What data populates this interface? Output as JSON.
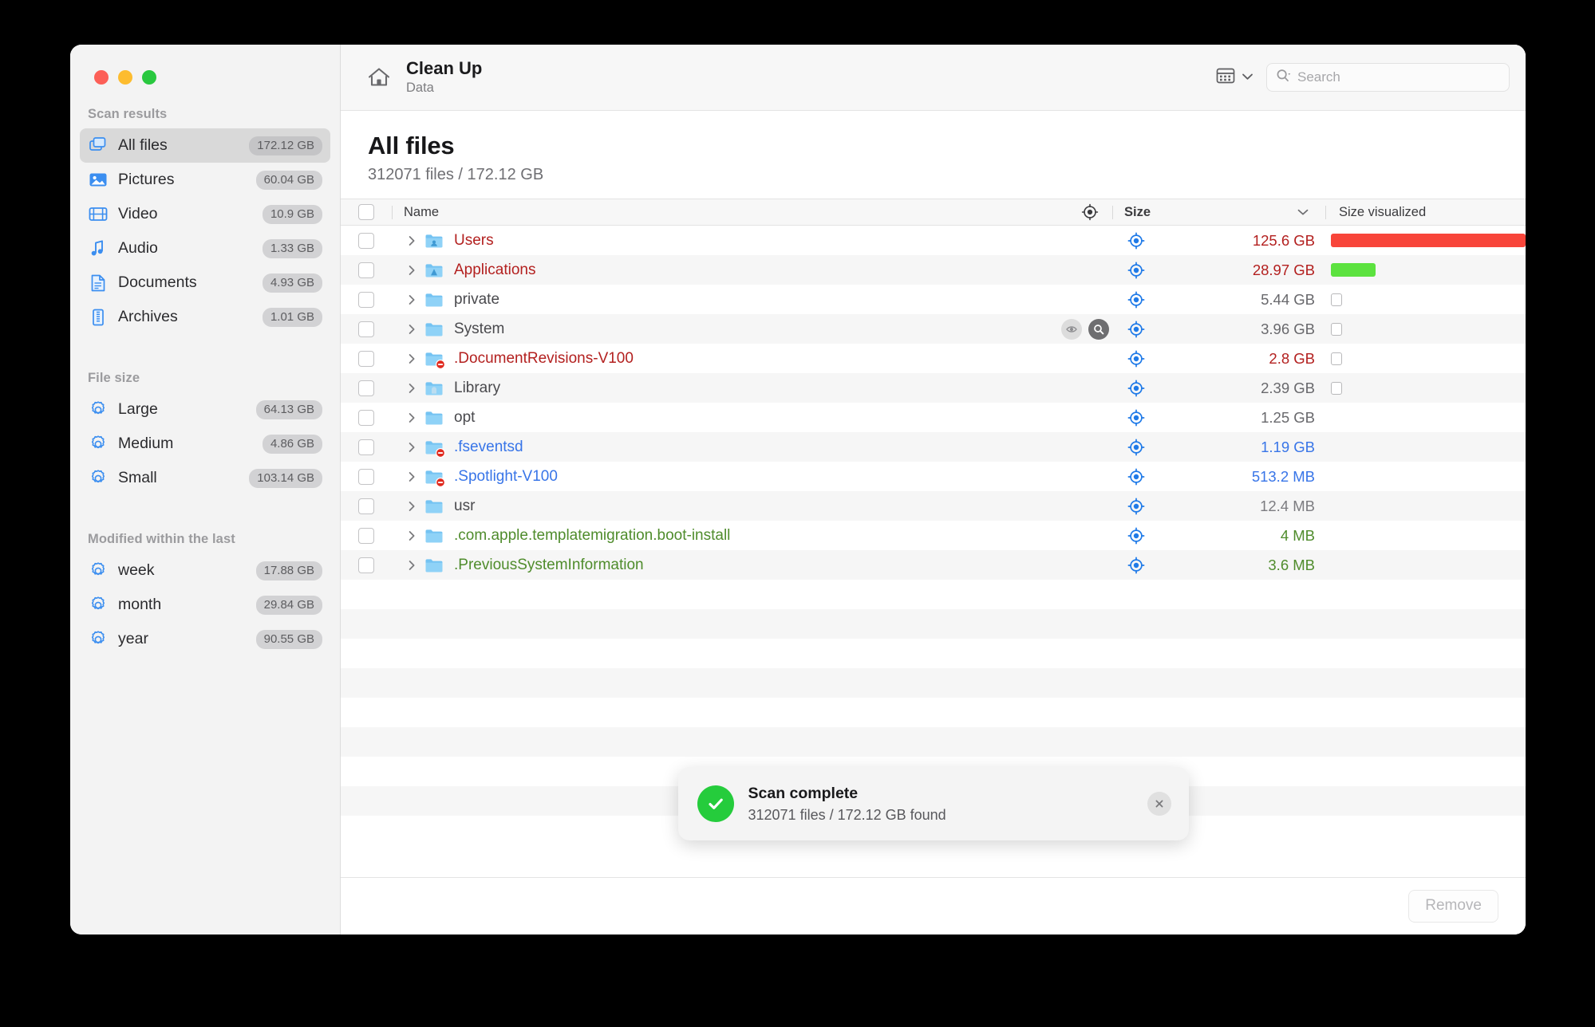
{
  "window": {
    "traffic_lights": [
      "close",
      "minimize",
      "zoom"
    ]
  },
  "toolbar": {
    "home_icon": "home-icon",
    "title": "Clean Up",
    "subtitle": "Data",
    "view_icon": "table-view-icon",
    "view_chevron": "chevron-down-icon",
    "search_icon": "search-icon",
    "search_placeholder": "Search",
    "search_value": ""
  },
  "sidebar": {
    "groups": [
      {
        "title": "Scan results",
        "items": [
          {
            "label": "All files",
            "badge": "172.12 GB",
            "icon": "all-files-icon",
            "active": true
          },
          {
            "label": "Pictures",
            "badge": "60.04 GB",
            "icon": "pictures-icon",
            "active": false
          },
          {
            "label": "Video",
            "badge": "10.9 GB",
            "icon": "video-icon",
            "active": false
          },
          {
            "label": "Audio",
            "badge": "1.33 GB",
            "icon": "audio-icon",
            "active": false
          },
          {
            "label": "Documents",
            "badge": "4.93 GB",
            "icon": "documents-icon",
            "active": false
          },
          {
            "label": "Archives",
            "badge": "1.01 GB",
            "icon": "archives-icon",
            "active": false
          }
        ]
      },
      {
        "title": "File size",
        "items": [
          {
            "label": "Large",
            "badge": "64.13 GB",
            "icon": "gear-icon",
            "active": false
          },
          {
            "label": "Medium",
            "badge": "4.86 GB",
            "icon": "gear-icon",
            "active": false
          },
          {
            "label": "Small",
            "badge": "103.14 GB",
            "icon": "gear-icon",
            "active": false
          }
        ]
      },
      {
        "title": "Modified within the last",
        "items": [
          {
            "label": "week",
            "badge": "17.88 GB",
            "icon": "gear-icon",
            "active": false
          },
          {
            "label": "month",
            "badge": "29.84 GB",
            "icon": "gear-icon",
            "active": false
          },
          {
            "label": "year",
            "badge": "90.55 GB",
            "icon": "gear-icon",
            "active": false
          }
        ]
      }
    ]
  },
  "main": {
    "page_title": "All files",
    "page_subtitle": "312071 files / 172.12 GB",
    "columns": {
      "name": "Name",
      "size": "Size",
      "size_visualized": "Size visualized",
      "target_icon": "target-icon",
      "sort_chevron": "chevron-down-icon"
    },
    "rows": [
      {
        "name": "Users",
        "size": "125.6 GB",
        "name_color": "#b3201f",
        "size_color": "#b3201f",
        "hidden_badge": false,
        "folder_kind": "users",
        "bar": {
          "type": "filled",
          "color": "#f8453a",
          "width_pct": 100
        }
      },
      {
        "name": "Applications",
        "size": "28.97 GB",
        "name_color": "#b3201f",
        "size_color": "#b3201f",
        "hidden_badge": false,
        "folder_kind": "applications",
        "bar": {
          "type": "filled",
          "color": "#5ce23f",
          "width_pct": 23
        }
      },
      {
        "name": "private",
        "size": "5.44 GB",
        "name_color": "#49494d",
        "size_color": "#68686c",
        "hidden_badge": false,
        "folder_kind": "plain",
        "bar": {
          "type": "empty"
        }
      },
      {
        "name": "System",
        "size": "3.96 GB",
        "name_color": "#49494d",
        "size_color": "#68686c",
        "hidden_badge": false,
        "folder_kind": "plain",
        "hover_actions": [
          "eye-icon",
          "magnifier-icon"
        ],
        "bar": {
          "type": "empty"
        }
      },
      {
        "name": ".DocumentRevisions-V100",
        "size": "2.8 GB",
        "name_color": "#b3201f",
        "size_color": "#b3201f",
        "hidden_badge": true,
        "folder_kind": "plain",
        "bar": {
          "type": "empty"
        }
      },
      {
        "name": "Library",
        "size": "2.39 GB",
        "name_color": "#49494d",
        "size_color": "#68686c",
        "hidden_badge": false,
        "folder_kind": "library",
        "bar": {
          "type": "empty"
        }
      },
      {
        "name": "opt",
        "size": "1.25 GB",
        "name_color": "#49494d",
        "size_color": "#68686c",
        "hidden_badge": false,
        "folder_kind": "plain",
        "bar": {
          "type": "none"
        }
      },
      {
        "name": ".fseventsd",
        "size": "1.19 GB",
        "name_color": "#3875e8",
        "size_color": "#3875e8",
        "hidden_badge": true,
        "folder_kind": "plain",
        "bar": {
          "type": "none"
        }
      },
      {
        "name": ".Spotlight-V100",
        "size": "513.2 MB",
        "name_color": "#3875e8",
        "size_color": "#3875e8",
        "hidden_badge": true,
        "folder_kind": "plain",
        "bar": {
          "type": "none"
        }
      },
      {
        "name": "usr",
        "size": "12.4 MB",
        "name_color": "#49494d",
        "size_color": "#7c7c80",
        "hidden_badge": false,
        "folder_kind": "plain",
        "bar": {
          "type": "none"
        }
      },
      {
        "name": ".com.apple.templatemigration.boot-install",
        "size": "4 MB",
        "name_color": "#4f8c2c",
        "size_color": "#4f8c2c",
        "hidden_badge": false,
        "folder_kind": "plain",
        "bar": {
          "type": "none"
        }
      },
      {
        "name": ".PreviousSystemInformation",
        "size": "3.6 MB",
        "name_color": "#4f8c2c",
        "size_color": "#4f8c2c",
        "hidden_badge": false,
        "folder_kind": "plain",
        "bar": {
          "type": "none"
        }
      }
    ],
    "empty_row_count": 9
  },
  "toast": {
    "status_icon": "checkmark-circle-icon",
    "title": "Scan complete",
    "message": "312071 files / 172.12 GB found",
    "close_icon": "close-icon"
  },
  "footer": {
    "remove_label": "Remove"
  },
  "colors": {
    "accent_blue": "#3b8ef0",
    "danger_red": "#f8453a",
    "success_green": "#25cc3c",
    "sidebar_bg": "#f3f3f3"
  }
}
